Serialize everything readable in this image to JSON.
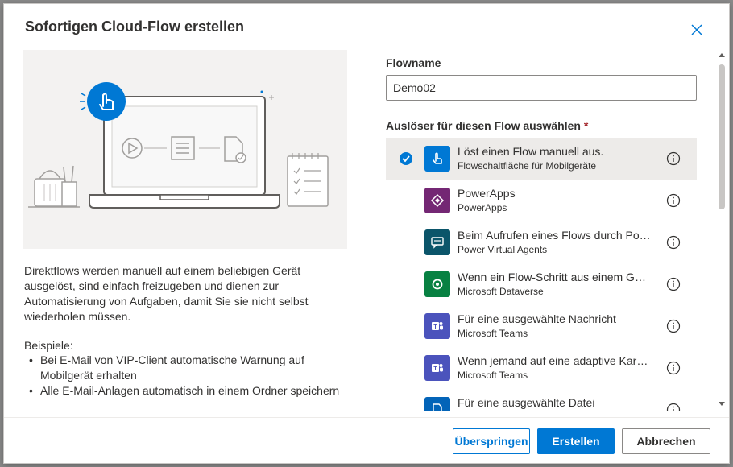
{
  "dialog": {
    "title": "Sofortigen Cloud-Flow erstellen"
  },
  "left": {
    "description": "Direktflows werden manuell auf einem beliebigen Gerät ausgelöst, sind einfach freizugeben und dienen zur Automatisierung von Aufgaben, damit Sie sie nicht selbst wiederholen müssen.",
    "examples_title": "Beispiele:",
    "examples": [
      "Bei E-Mail von VIP-Client automatische Warnung auf Mobilgerät erhalten",
      "Alle E-Mail-Anlagen automatisch in einem Ordner speichern"
    ]
  },
  "form": {
    "flowname_label": "Flowname",
    "flowname_value": "Demo02",
    "trigger_label": "Auslöser für diesen Flow auswählen",
    "required_mark": "*"
  },
  "triggers": [
    {
      "name": "Löst einen Flow manuell aus.",
      "sub": "Flowschaltfläche für Mobilgeräte",
      "icon": "hand-tap-icon",
      "color": "#0078d4",
      "selected": true
    },
    {
      "name": "PowerApps",
      "sub": "PowerApps",
      "icon": "powerapps-icon",
      "color": "#742774",
      "selected": false
    },
    {
      "name": "Beim Aufrufen eines Flows durch Power Virtual Agents",
      "sub": "Power Virtual Agents",
      "icon": "chat-bot-icon",
      "color": "#0b556a",
      "selected": false
    },
    {
      "name": "Wenn ein Flow-Schritt aus einem Geschäftsprozess ausgeführt wird",
      "sub": "Microsoft Dataverse",
      "icon": "dataverse-icon",
      "color": "#088142",
      "selected": false
    },
    {
      "name": "Für eine ausgewählte Nachricht",
      "sub": "Microsoft Teams",
      "icon": "teams-icon",
      "color": "#4b53bc",
      "selected": false
    },
    {
      "name": "Wenn jemand auf eine adaptive Karte reagiert",
      "sub": "Microsoft Teams",
      "icon": "teams-icon",
      "color": "#4b53bc",
      "selected": false
    },
    {
      "name": "Für eine ausgewählte Datei",
      "sub": "",
      "icon": "file-icon",
      "color": "#0364b8",
      "selected": false
    }
  ],
  "buttons": {
    "skip": "Überspringen",
    "create": "Erstellen",
    "cancel": "Abbrechen"
  },
  "colors": {
    "accent": "#0078d4",
    "selected_row": "#edebe9"
  }
}
